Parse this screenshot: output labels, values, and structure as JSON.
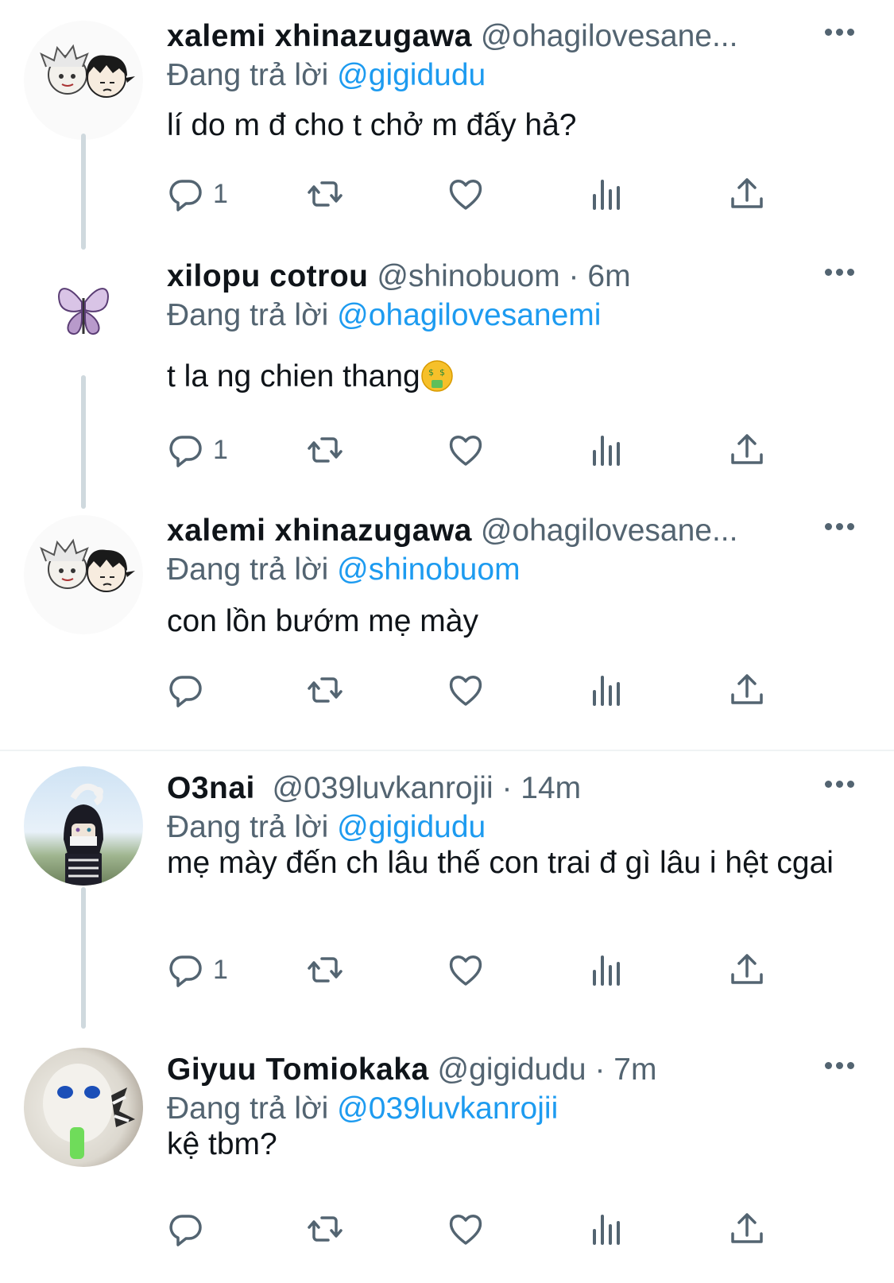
{
  "tweets": [
    {
      "name": "xalemi xhinazugawa",
      "handle": "@ohagilovesane...",
      "reply_label": "Đang trả lời",
      "reply_to": "@gigidudu",
      "text": "lí do m đ cho t chở m đấy hả?",
      "reply_count": "1"
    },
    {
      "name": "xilopu cotrou",
      "handle": "@shinobuom · 6m",
      "reply_label": "Đang trả lời",
      "reply_to": "@ohagilovesanemi",
      "text": "t la ng chien thang",
      "emoji": "money-mouth-face-icon",
      "reply_count": "1"
    },
    {
      "name": "xalemi xhinazugawa",
      "handle": "@ohagilovesane...",
      "reply_label": "Đang trả lời",
      "reply_to": "@shinobuom",
      "text": "con lồn bướm mẹ mày",
      "reply_count": ""
    },
    {
      "name": "O3nai",
      "handle": "@039luvkanrojii · 14m",
      "reply_label": "Đang trả lời",
      "reply_to": "@gigidudu",
      "text": "mẹ mày đến ch lâu thế con trai đ gì lâu i hệt cgai",
      "reply_count": "1"
    },
    {
      "name": "Giyuu Tomiokaka",
      "handle": "@gigidudu · 7m",
      "reply_label": "Đang trả lời",
      "reply_to": "@039luvkanrojii",
      "text": "kệ tbm?",
      "reply_count": ""
    }
  ],
  "colors": {
    "accent": "#1d9bf0",
    "secondary_text": "#536471",
    "thread_line": "#cfd9de"
  }
}
